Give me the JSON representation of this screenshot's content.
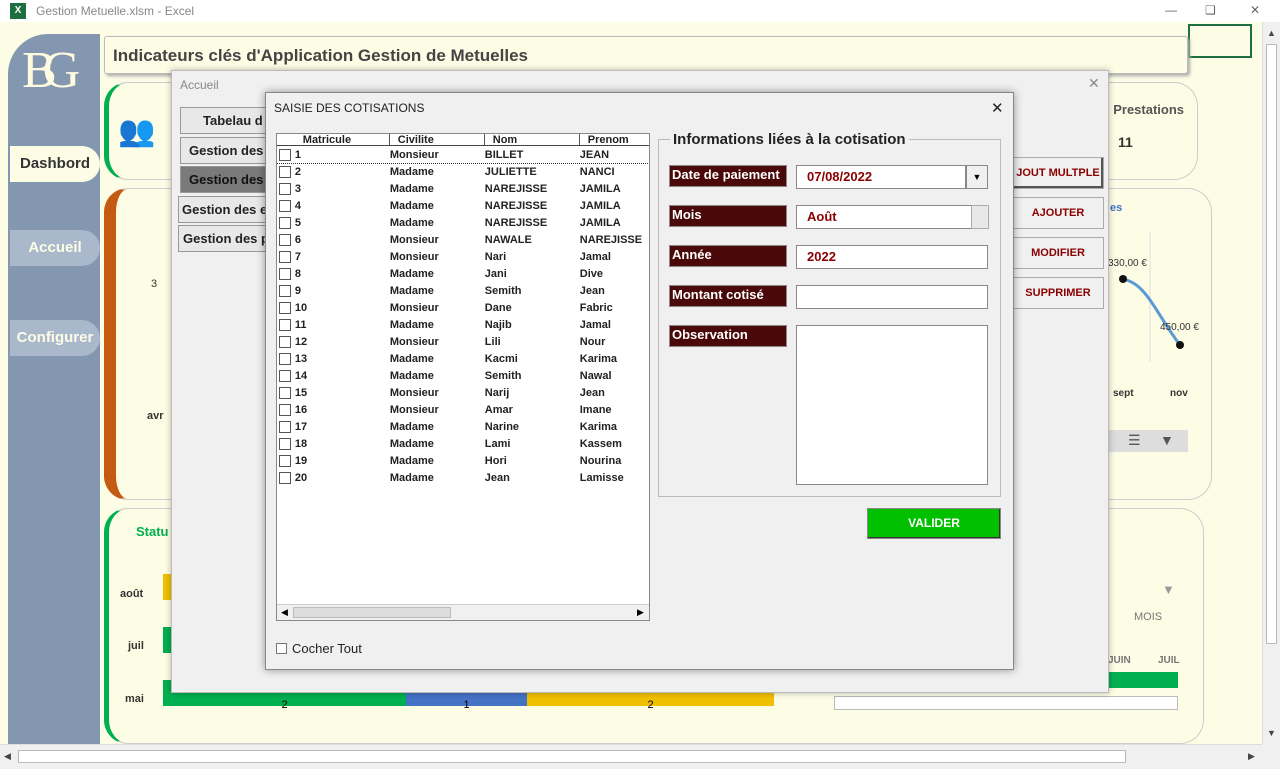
{
  "app": {
    "title": "Gestion Metuelle.xlsm - Excel",
    "excel_icon": "X"
  },
  "dashboard": {
    "banner": "Indicateurs clés d'Application Gestion de Metuelles",
    "logo": "BG",
    "nav": [
      "Dashbord",
      "Accueil",
      "Configurer"
    ],
    "prestations_label": "l Prestations",
    "prestations_value": "11",
    "chart_top": {
      "label_left": "3",
      "x_left": "avr",
      "x_right": [
        "sept",
        "nov"
      ],
      "value_1": "330,00 €",
      "value_2": "450,00 €",
      "legend_partial": "es"
    },
    "status_label": "Statu",
    "bottom_chart": {
      "categories": [
        "août",
        "juil",
        "mai"
      ],
      "values": [
        "2",
        "1",
        "2"
      ]
    },
    "mois_label": "MOIS",
    "months": [
      "JUIN",
      "JUIL"
    ]
  },
  "accueil": {
    "title": "Accueil",
    "buttons": [
      "Tabelau d",
      "Gestion des",
      "Gestion des",
      "Gestion des e",
      "Gestion des p"
    ],
    "right_buttons": [
      "JOUT MULTPLE",
      "AJOUTER",
      "MODIFIER",
      "SUPPRIMER"
    ]
  },
  "dialog": {
    "title": "SAISIE DES COTISATIONS",
    "columns": [
      "Matricule",
      "Civilite",
      "Nom",
      "Prenom"
    ],
    "rows": [
      [
        "1",
        "Monsieur",
        "BILLET",
        "JEAN"
      ],
      [
        "2",
        "Madame",
        "JULIETTE",
        "NANCI"
      ],
      [
        "3",
        "Madame",
        "NAREJISSE",
        "JAMILA"
      ],
      [
        "4",
        "Madame",
        "NAREJISSE",
        "JAMILA"
      ],
      [
        "5",
        "Madame",
        "NAREJISSE",
        "JAMILA"
      ],
      [
        "6",
        "Monsieur",
        "NAWALE",
        "NAREJISSE"
      ],
      [
        "7",
        "Monsieur",
        "Nari",
        "Jamal"
      ],
      [
        "8",
        "Madame",
        "Jani",
        "Dive"
      ],
      [
        "9",
        "Madame",
        "Semith",
        "Jean"
      ],
      [
        "10",
        "Monsieur",
        "Dane",
        "Fabric"
      ],
      [
        "11",
        "Madame",
        "Najib",
        "Jamal"
      ],
      [
        "12",
        "Monsieur",
        "Lili",
        "Nour"
      ],
      [
        "13",
        "Madame",
        "Kacmi",
        "Karima"
      ],
      [
        "14",
        "Madame",
        "Semith",
        "Nawal"
      ],
      [
        "15",
        "Monsieur",
        "Narij",
        "Jean"
      ],
      [
        "16",
        "Monsieur",
        "Amar",
        "Imane"
      ],
      [
        "17",
        "Madame",
        "Narine",
        "Karima"
      ],
      [
        "18",
        "Madame",
        "Lami",
        "Kassem"
      ],
      [
        "19",
        "Madame",
        "Hori",
        "Nourina"
      ],
      [
        "20",
        "Madame",
        "Jean",
        "Lamisse"
      ]
    ],
    "select_all": "Cocher Tout",
    "group_title": "Informations liées à la cotisation",
    "labels": {
      "date": "Date de paiement",
      "mois": "Mois",
      "annee": "Année",
      "montant": "Montant cotisé",
      "observation": "Observation"
    },
    "values": {
      "date": "07/08/2022",
      "mois": "Août",
      "annee": "2022",
      "montant": "",
      "observation": ""
    },
    "validate": "VALIDER"
  },
  "colors": {
    "accent_green": "#00c000",
    "label_bg": "#4a0808",
    "value_red": "#8b0000"
  }
}
